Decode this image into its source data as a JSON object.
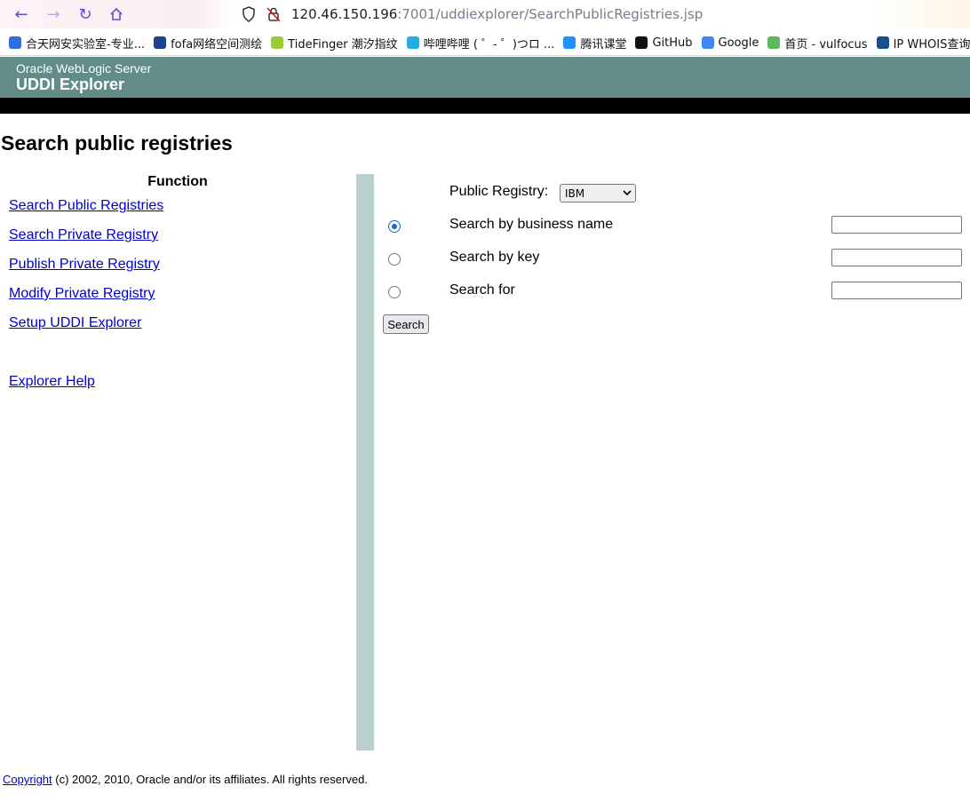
{
  "browser": {
    "url_host": "120.46.150.196",
    "url_path": ":7001/uddiexplorer/SearchPublicRegistries.jsp",
    "bookmarks": [
      {
        "label": "合天网安实验室-专业...",
        "color": "#2f6fe0"
      },
      {
        "label": "fofa网络空间测绘",
        "color": "#1f3f8f"
      },
      {
        "label": "TideFinger 潮汐指纹",
        "color": "#9acd32"
      },
      {
        "label": "哔哩哔哩 ( ゜- ゜)つロ ...",
        "color": "#23ade5"
      },
      {
        "label": "腾讯课堂",
        "color": "#1e90ff"
      },
      {
        "label": "GitHub",
        "color": "#111111"
      },
      {
        "label": "Google",
        "color": "#4285f4"
      },
      {
        "label": "首页 - vulfocus",
        "color": "#5cb85c"
      },
      {
        "label": "IP WHOIS查询 - 站长...",
        "color": "#1a4f8f"
      }
    ]
  },
  "header": {
    "subtitle": "Oracle WebLogic Server",
    "title": "UDDI Explorer"
  },
  "page_title": "Search public registries",
  "sidebar": {
    "heading": "Function",
    "links": [
      "Search Public Registries",
      "Search Private Registry",
      "Publish Private Registry",
      "Modify Private Registry",
      "Setup UDDI Explorer",
      "Explorer Help"
    ]
  },
  "form": {
    "registry_label": "Public Registry:",
    "registry_value": "IBM",
    "options": [
      {
        "label": "Search by business name",
        "checked": true,
        "value": ""
      },
      {
        "label": "Search by key",
        "checked": false,
        "value": ""
      },
      {
        "label": "Search for",
        "checked": false,
        "value": ""
      }
    ],
    "search_button": "Search"
  },
  "footer": {
    "link": "Copyright",
    "text": " (c) 2002, 2010, Oracle and/or its affiliates. All rights reserved."
  }
}
